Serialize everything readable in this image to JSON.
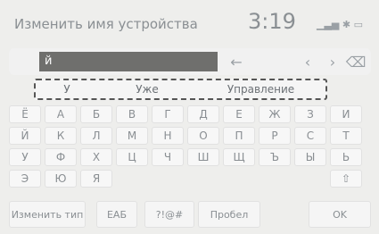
{
  "header": {
    "title": "Изменить имя устройства",
    "clock": "3:19",
    "status_icons": [
      "signal-icon",
      "bluetooth-icon",
      "battery-icon"
    ]
  },
  "text_input": {
    "value": "й"
  },
  "controls": {
    "back_arrow": "←",
    "left_arrow": "‹",
    "right_arrow": "›",
    "delete": "⌫"
  },
  "suggestions": [
    "У",
    "Уже",
    "Управление"
  ],
  "keyboard_rows": [
    [
      "Ё",
      "А",
      "Б",
      "В",
      "Г",
      "Д",
      "Е",
      "Ж",
      "З",
      "И"
    ],
    [
      "Й",
      "К",
      "Л",
      "М",
      "Н",
      "О",
      "П",
      "Р",
      "С",
      "Т"
    ],
    [
      "У",
      "Ф",
      "Х",
      "Ц",
      "Ч",
      "Ш",
      "Щ",
      "Ъ",
      "Ы",
      "Ь"
    ],
    [
      "Э",
      "Ю",
      "Я"
    ]
  ],
  "extra_key": "⇧",
  "bottom_bar": {
    "change_type": "Изменить тип",
    "eab": "EAБ",
    "symbols": "?!@#",
    "space": "Пробел",
    "ok": "OK"
  }
}
